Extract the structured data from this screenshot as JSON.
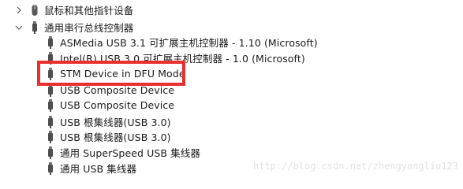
{
  "device_manager": {
    "categories": [
      {
        "label": "鼠标和其他指针设备",
        "state": "collapsed",
        "chevron_icon": "chevron-right-icon",
        "icon": "mouse-icon"
      },
      {
        "label": "通用串行总线控制器",
        "state": "expanded",
        "chevron_icon": "chevron-down-icon",
        "icon": "usb-controller-icon"
      }
    ],
    "devices": [
      {
        "label": "ASMedia USB 3.1 可扩展主机控制器 - 1.10 (Microsoft)",
        "icon": "usb-device-icon"
      },
      {
        "label": "Intel(R) USB 3.0 可扩展主机控制器 - 1.0 (Microsoft)",
        "icon": "usb-device-icon"
      },
      {
        "label": "STM Device in DFU Mode",
        "icon": "usb-device-icon",
        "highlighted": true
      },
      {
        "label": "USB Composite Device",
        "icon": "usb-device-icon"
      },
      {
        "label": "USB Composite Device",
        "icon": "usb-device-icon"
      },
      {
        "label": "USB 根集线器(USB 3.0)",
        "icon": "usb-device-icon"
      },
      {
        "label": "USB 根集线器(USB 3.0)",
        "icon": "usb-device-icon"
      },
      {
        "label": "通用 SuperSpeed USB 集线器",
        "icon": "usb-device-icon"
      },
      {
        "label": "通用 USB 集线器",
        "icon": "usb-device-icon"
      }
    ],
    "highlight_color": "#e8302f"
  },
  "watermark": "http://blog.csdn.net/zhengyangliu123"
}
